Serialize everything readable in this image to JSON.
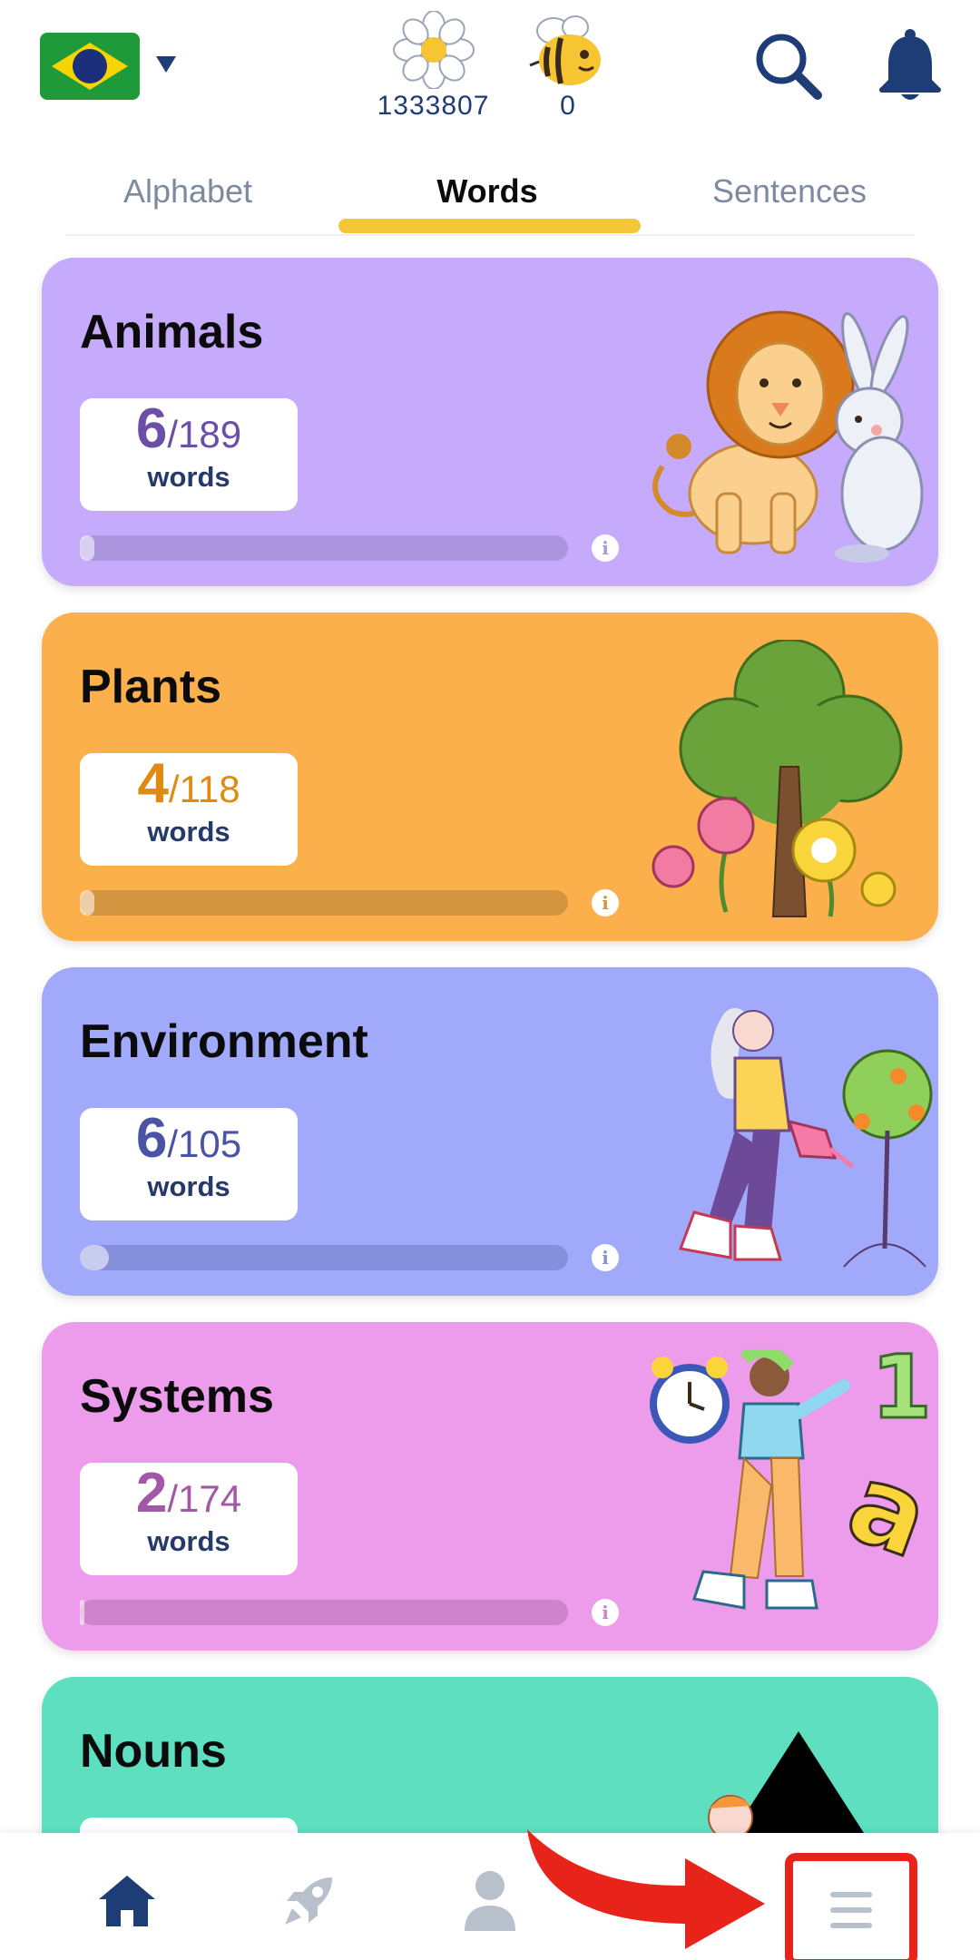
{
  "header": {
    "flag_icon": "brazil-flag-icon",
    "flowers": {
      "icon": "daisy-flower-icon",
      "count": "1333807"
    },
    "bees": {
      "icon": "bee-icon",
      "count": "0"
    },
    "search_icon": "search-icon",
    "bell_icon": "bell-icon"
  },
  "tabs": [
    {
      "label": "Alphabet",
      "active": false
    },
    {
      "label": "Words",
      "active": true
    },
    {
      "label": "Sentences",
      "active": false
    }
  ],
  "categories": [
    {
      "title": "Animals",
      "done": "6",
      "total": "/189",
      "unit": "words",
      "progress": 0.03,
      "illustration": "lion-and-rabbit"
    },
    {
      "title": "Plants",
      "done": "4",
      "total": "/118",
      "unit": "words",
      "progress": 0.03,
      "illustration": "tree-and-flowers"
    },
    {
      "title": "Environment",
      "done": "6",
      "total": "/105",
      "unit": "words",
      "progress": 0.06,
      "illustration": "woman-watering-tree"
    },
    {
      "title": "Systems",
      "done": "2",
      "total": "/174",
      "unit": "words",
      "progress": 0.01,
      "illustration": "girl-with-clock-and-letters"
    },
    {
      "title": "Nouns",
      "illustration": "boy-with-triangle"
    }
  ],
  "bottom_nav": [
    {
      "icon": "home-icon",
      "active": true
    },
    {
      "icon": "rocket-icon",
      "active": false
    },
    {
      "icon": "profile-icon",
      "active": false
    },
    {
      "icon": "menu-icon",
      "active": false,
      "highlighted": true
    }
  ],
  "colors": {
    "primary": "#1e3d76",
    "tab_indicator": "#f5c63a",
    "animals": "#c6aafb",
    "plants": "#fbb04c",
    "environment": "#a1aafa",
    "systems": "#ec9cea",
    "nouns": "#5ddfc0",
    "highlight": "#e8241a"
  }
}
